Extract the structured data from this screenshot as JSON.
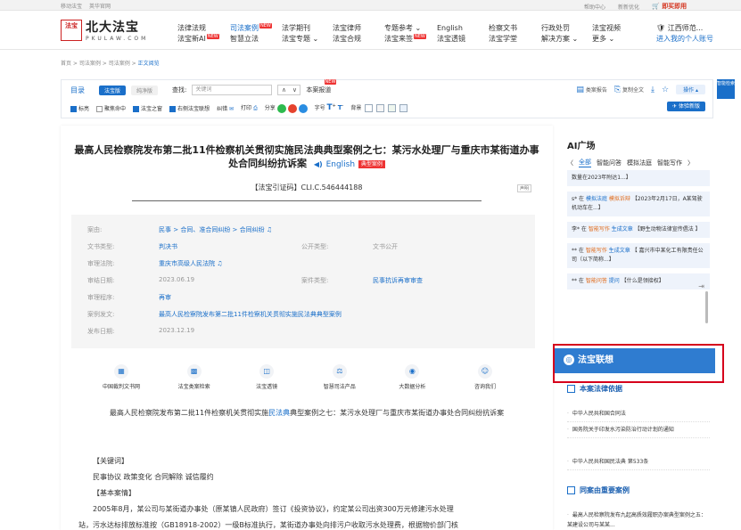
{
  "topbar": {
    "left_links": [
      "移动法宝",
      "英华官网"
    ],
    "right_links": [
      "帮助中心",
      "新新优化"
    ],
    "buy_label": "即买即用"
  },
  "header": {
    "seal_text": "法宝",
    "logo_cn": "北大法宝",
    "logo_en": "PKULAW.COM",
    "nav": [
      {
        "line1": "法律法规",
        "line2": "法宝新AI",
        "new": false
      },
      {
        "line1": "司法案例",
        "line2": "智慧立法",
        "new": true
      },
      {
        "line1": "法学期刊",
        "line2": "法宝专题",
        "new": false
      },
      {
        "line1": "法宝律师",
        "line2": "法宝合规",
        "new": false
      },
      {
        "line1": "专题参考",
        "line2": "法宝来签",
        "new": true
      },
      {
        "line1": "English",
        "line2": "法宝透镜",
        "new": false
      },
      {
        "line1": "检察文书",
        "line2": "法宝学堂",
        "new": false
      },
      {
        "line1": "行政处罚",
        "line2": "解决方案",
        "new": false
      },
      {
        "line1": "法宝视频",
        "line2": "更多",
        "new": false
      }
    ],
    "new_badge": "NEW",
    "user_name": "江西师范...",
    "user_link": "进入我的个人账号"
  },
  "breadcrumb": {
    "items": [
      "首页",
      "司法案例",
      "司法案例"
    ],
    "current": "正文阅览"
  },
  "toolbar": {
    "catalog": "目录",
    "mode_on": "法宝版",
    "mode_off": "纯净版",
    "find_label": "查找:",
    "search_placeholder": "关键词",
    "report_label": "本案报道",
    "case_report": "类案报告",
    "copy_full": "复制全文",
    "ops_label": "操作",
    "options": [
      "标亮",
      "聚焦命中",
      "法宝之窗",
      "右侧法宝联想"
    ],
    "proofread": "纠错",
    "print": "打印",
    "share": "分享",
    "font_size": "字号",
    "background": "背景",
    "try_new": "体验新版"
  },
  "side_tag": "智能检索",
  "article": {
    "title_main": "最高人民检察院发布第二批11件检察机关贯彻实施民法典典型案例之七：某污水处理厂与重庆市某街道办事处合同纠纷抗诉案",
    "english": "English",
    "badge": "典型案例",
    "citation": "【法宝引证码】CLI.C.546444188",
    "disclaimer": "声明",
    "meta": {
      "cause_label": "案由:",
      "cause_value": "民事 > 合同、准合同纠纷 > 合同纠纷",
      "doc_type_label": "文书类型:",
      "doc_type_value": "判决书",
      "public_type_label": "公开类型:",
      "public_type_value": "文书公开",
      "court_label": "审理法院:",
      "court_value": "重庆市高级人民法院",
      "trial_date_label": "审结日期:",
      "trial_date_value": "2023.06.19",
      "case_type_label": "案件类型:",
      "case_type_value": "民事抗诉再审审查",
      "procedure_label": "审理程序:",
      "procedure_value": "再审",
      "publisher_label": "案例发文:",
      "publisher_value": "最高人民检察院发布第二批11件检察机关贯彻实施民法典典型案例",
      "publish_date_label": "发布日期:",
      "publish_date_value": "2023.12.19"
    },
    "tools": [
      "中国裁判文书网",
      "法宝类案检索",
      "法宝透镜",
      "智慧司法产品",
      "大数据分析",
      "咨询我们"
    ],
    "subtitle_pre": "最高人民检察院发布第二批11件检察机关贯彻实施",
    "subtitle_link": "民法典",
    "subtitle_post": "典型案例之七：某污水处理厂与重庆市某街道办事处合同纠纷抗诉案",
    "keywords_head": "【关键词】",
    "keywords": "民事协议 政策变化 合同解除 诚信履约",
    "facts_head": "【基本案情】",
    "facts_line1": "2005年8月，某公司与某街道办事处（原某镇人民政府）签订《投资协议》，约定某公司出资300万元修建污水处理",
    "facts_line2": "站，污水达标排放标准按（GB18918-2002）一级B标准执行，某街道办事处向排污户收取污水处理费，根据物价部门核"
  },
  "right": {
    "ai_title": "AI广场",
    "tabs": [
      "全部",
      "智能问答",
      "模拟法庭",
      "智能写作"
    ],
    "cards": [
      {
        "text": "数量在2023年附达1...】"
      },
      {
        "user": "s* 在",
        "tag1": "模拟法庭",
        "tag2": "模拟诉辩",
        "text": "【2023年2月17日，A某驾驶机动车在...】"
      },
      {
        "user": "李* 在",
        "tag1": "智能写作",
        "tag2": "生成文章",
        "text": "【野生动物法律宣传倡法 】"
      },
      {
        "user": "** 在",
        "tag1": "智能写作",
        "tag2": "生成文章",
        "text": "【 嘉兴市中某化工有限责任公司（以下简称...】"
      },
      {
        "user": "** 在",
        "tag1": "智能问答",
        "tag2": "提问",
        "text": "【什么是领接权】"
      }
    ],
    "fb_button": "法宝联想",
    "related_law_head": "本案法律依据",
    "related_laws": [
      "中华人民共和国合同法",
      "国务院关于印发水污染防治行动计划的通知",
      "中华人民共和国民法典 第533条"
    ],
    "same_cause_head": "同案由重要案例",
    "same_cause_items": [
      "最高人民检察院发布九起高质效履职办案典型案例之五：某建设公司与某某..."
    ]
  }
}
